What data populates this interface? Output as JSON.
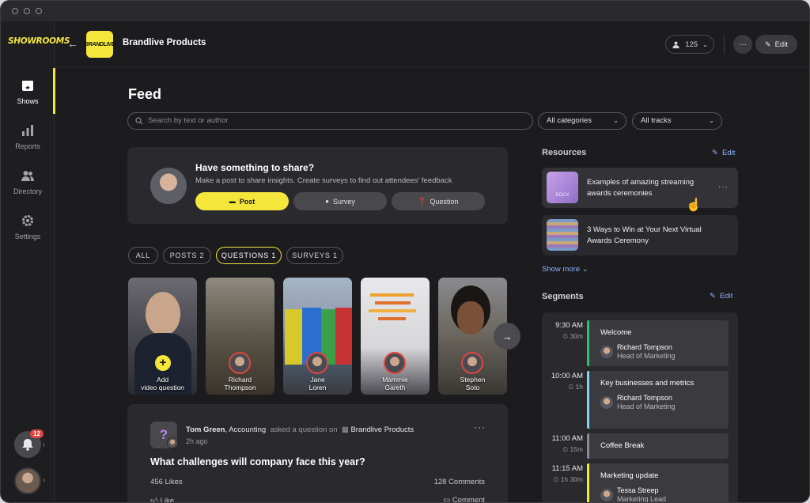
{
  "rail": {
    "logo": "SHOWROOMS",
    "items": [
      {
        "label": "Shows"
      },
      {
        "label": "Reports"
      },
      {
        "label": "Directory"
      },
      {
        "label": "Settings"
      }
    ],
    "notifications_count": "12"
  },
  "header": {
    "title": "Brandlive Products",
    "brand_logo_text": "BRANDLIVE",
    "attendee_count": "125",
    "more_label": "···",
    "edit_label": "Edit"
  },
  "feed": {
    "title": "Feed",
    "search_placeholder": "Search by text or author",
    "category_select": "All categories",
    "track_select": "All tracks"
  },
  "share": {
    "title": "Have something to share?",
    "subtitle": "Make a post to share insights. Create surveys to find out attendees' feedback",
    "post_label": "Post",
    "survey_label": "Survey",
    "question_label": "Question"
  },
  "filters": {
    "all": "ALL",
    "posts": "POSTS 2",
    "questions": "QUESTIONS 1",
    "surveys": "SURVEYS 1"
  },
  "stories": {
    "add_line1": "Add",
    "add_line2": "video question",
    "people": [
      {
        "first": "Richard",
        "last": "Thompson"
      },
      {
        "first": "Jane",
        "last": "Loren"
      },
      {
        "first": "Mammie",
        "last": "Gareth"
      },
      {
        "first": "Stephen",
        "last": "Soto"
      }
    ]
  },
  "post": {
    "author": "Tom Green",
    "author_suffix": ", Accounting",
    "action": "asked a question on",
    "target": "Brandlive Products",
    "time": "2h ago",
    "question": "What challenges will  company face this year?",
    "likes": "456 Likes",
    "comments": "128 Comments",
    "like_label": "Like",
    "comment_label": "Comment"
  },
  "resources": {
    "title": "Resources",
    "edit_label": "Edit",
    "items": [
      {
        "title": "Examples of amazing streaming awards ceremonies",
        "badge": "DOCX"
      },
      {
        "title": "3 Ways to Win at Your Next Virtual Awards Ceremony"
      }
    ],
    "show_more": "Show more"
  },
  "segments": {
    "title": "Segments",
    "edit_label": "Edit",
    "items": [
      {
        "time": "9:30 AM",
        "duration": "30m",
        "name": "Welcome",
        "person": "Richard Tompson",
        "role": "Head of Marketing",
        "color": "#2fbf71"
      },
      {
        "time": "10:00 AM",
        "duration": "1h",
        "name": "Key businesses and metrics",
        "person": "Richard Tompson",
        "role": "Head of Marketing",
        "color": "#7fd6f5"
      },
      {
        "time": "11:00 AM",
        "duration": "15m",
        "name": "Coffee Break",
        "color": "#8a8a90"
      },
      {
        "time": "11:15 AM",
        "duration": "1h 30m",
        "name": "Marketing update",
        "person": "Tessa Streep",
        "role": "Marketing Lead",
        "color": "#f5e63c"
      }
    ]
  },
  "colors": {
    "accent": "#f5e63c",
    "link": "#8fb2ff",
    "background": "#1c1c1f",
    "card": "#2a2a2e"
  }
}
